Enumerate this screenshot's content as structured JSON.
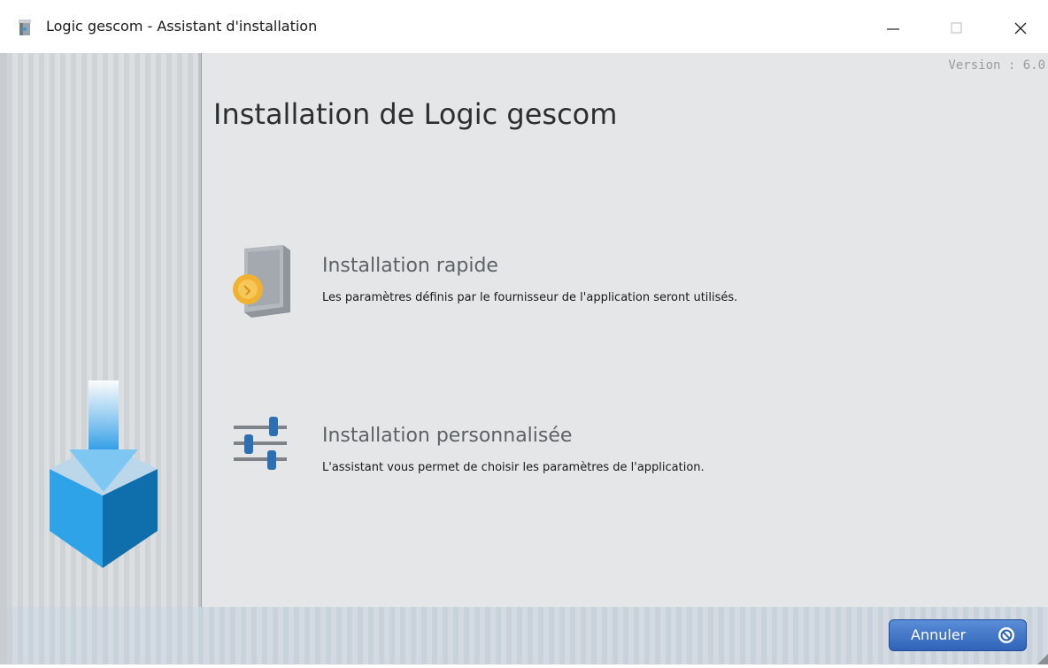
{
  "window": {
    "title": "Logic gescom - Assistant d'installation",
    "controls": {
      "minimize": "—",
      "maximize": "☐",
      "close": "✕"
    }
  },
  "header": {
    "version": "Version : 6.0",
    "title": "Installation de Logic gescom"
  },
  "options": [
    {
      "title": "Installation rapide",
      "description": "Les paramètres définis par le fournisseur de l'application seront utilisés.",
      "icon": "quick-install-icon"
    },
    {
      "title": "Installation personnalisée",
      "description": "L'assistant vous permet de choisir les paramètres de l'application.",
      "icon": "sliders-icon"
    }
  ],
  "footer": {
    "cancel_label": "Annuler",
    "cancel_icon": "cancel-icon"
  },
  "colors": {
    "accent": "#2f63b8",
    "arrow": "#42a7e8",
    "box_dark": "#1572b0",
    "coin": "#f2b231"
  }
}
